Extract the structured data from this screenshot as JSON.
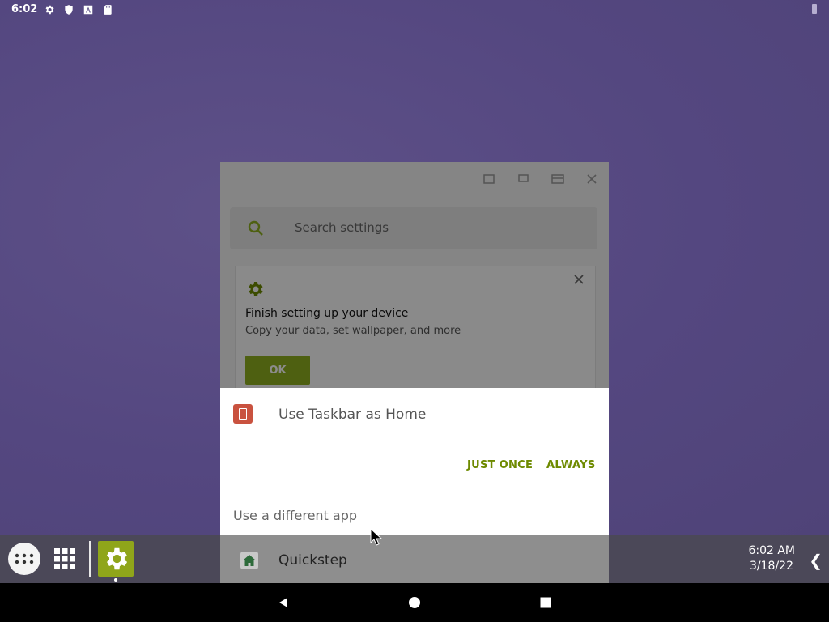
{
  "status_bar": {
    "time": "6:02",
    "icons": [
      "gear-icon",
      "shield-icon",
      "font-icon",
      "sd-card-icon"
    ]
  },
  "settings_window": {
    "search_placeholder": "Search settings",
    "card": {
      "title": "Finish setting up your device",
      "subtitle": "Copy your data, set wallpaper, and more",
      "ok_label": "OK"
    }
  },
  "chooser": {
    "app_name": "Use Taskbar as Home",
    "just_once": "JUST ONCE",
    "always": "ALWAYS",
    "different_app": "Use a different app",
    "alt_app": "Quickstep"
  },
  "taskbar": {
    "time": "6:02 AM",
    "date": "3/18/22"
  },
  "colors": {
    "accent": "#6e8a00",
    "ok_button": "#8fb020",
    "wallpaper": "#574b85"
  }
}
